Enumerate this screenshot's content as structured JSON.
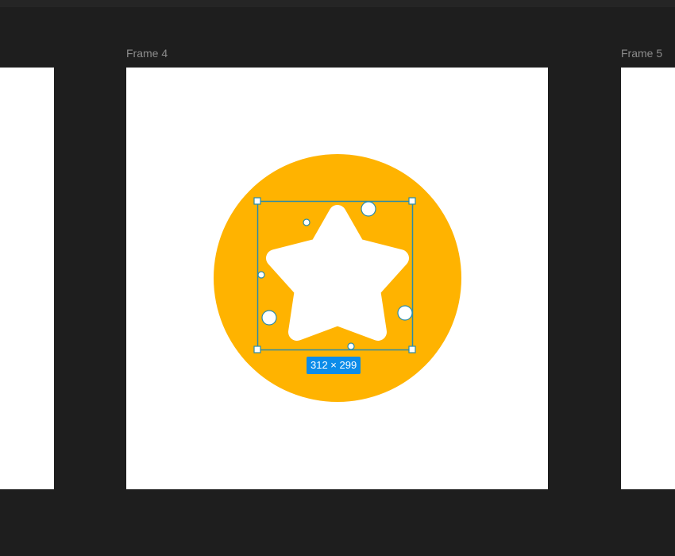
{
  "canvas": {
    "frames": [
      {
        "label": ""
      },
      {
        "label": "Frame 4"
      },
      {
        "label": "Frame 5"
      }
    ]
  },
  "selection": {
    "size_label": "312 × 299"
  },
  "colors": {
    "canvas_bg": "#1e1e1e",
    "frame_bg": "#ffffff",
    "circle_fill": "#ffb300",
    "star_fill": "#ffffff",
    "selection_stroke": "#2a8ba8",
    "badge_bg": "#0c8ce9"
  },
  "icons": {
    "shape": "star-in-circle-icon"
  }
}
